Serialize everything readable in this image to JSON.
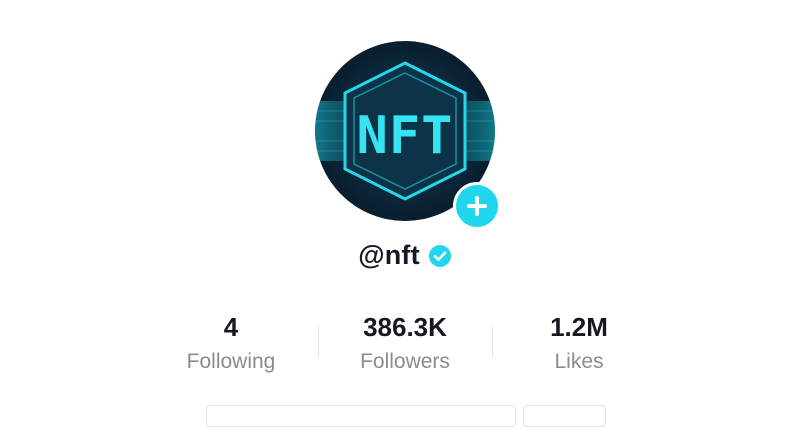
{
  "profile": {
    "avatar_logo_text": "NFT",
    "username": "@nft",
    "verified": true
  },
  "stats": [
    {
      "value": "4",
      "label": "Following"
    },
    {
      "value": "386.3K",
      "label": "Followers"
    },
    {
      "value": "1.2M",
      "label": "Likes"
    }
  ],
  "colors": {
    "accent_plus": "#20d5ec",
    "verified_badge": "#20d5ec",
    "text_primary": "#161823",
    "text_secondary": "#8a8b91"
  },
  "icons": {
    "follow": "plus-icon",
    "verified": "verified-badge-icon"
  }
}
